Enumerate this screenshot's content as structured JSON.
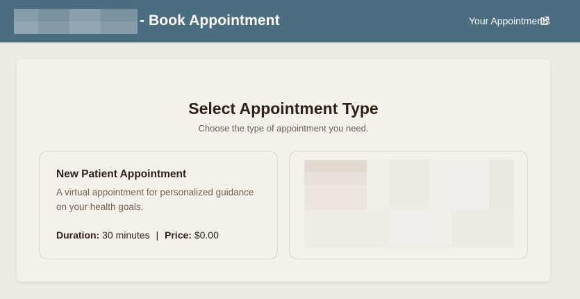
{
  "header": {
    "title": "- Book Appointment",
    "your_appointments_label": "Your Appointments",
    "external_icon": "external-link-icon"
  },
  "main": {
    "title": "Select Appointment Type",
    "subtitle": "Choose the type of appointment you need.",
    "options": [
      {
        "title": "New Patient Appointment",
        "description": "A virtual appointment for personalized guidance on your health goals.",
        "duration_label": "Duration:",
        "duration_value": "30 minutes",
        "separator": "|",
        "price_label": "Price:",
        "price_value": "$0.00"
      }
    ]
  },
  "colors": {
    "header_bg": "#4a6d80",
    "page_bg": "#efebe4",
    "card_bg": "#f4f1eb",
    "text_primary": "#2e2118",
    "text_secondary": "#76604f"
  }
}
